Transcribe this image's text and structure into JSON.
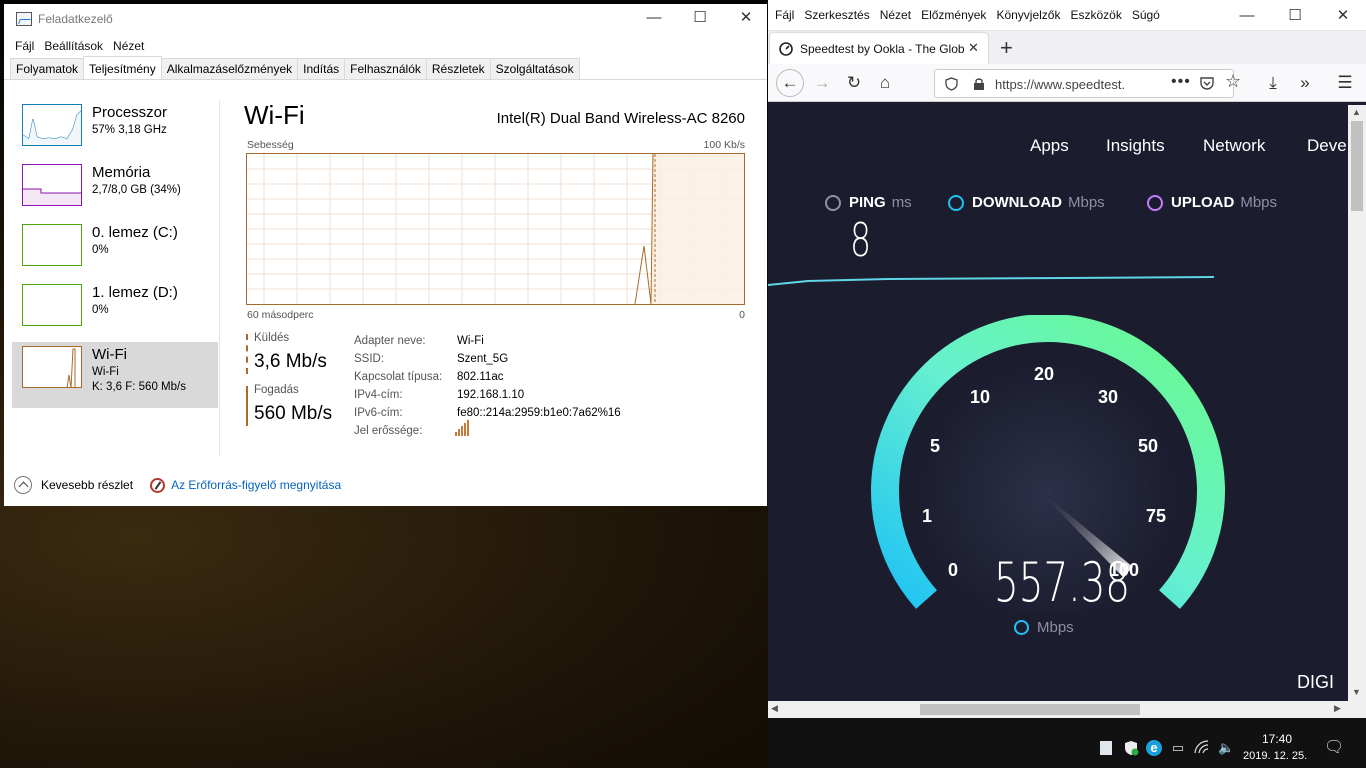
{
  "task_manager": {
    "title": "Feladatkezelő",
    "menu": [
      "Fájl",
      "Beállítások",
      "Nézet"
    ],
    "tabs": [
      "Folyamatok",
      "Teljesítmény",
      "Alkalmazáselőzmények",
      "Indítás",
      "Felhasználók",
      "Részletek",
      "Szolgáltatások"
    ],
    "active_tab": "Teljesítmény",
    "sidebar": [
      {
        "name": "Processzor",
        "sub1": "57%  3,18 GHz",
        "sub2": "",
        "sub3": ""
      },
      {
        "name": "Memória",
        "sub1": "2,7/8,0 GB (34%)",
        "sub2": "",
        "sub3": ""
      },
      {
        "name": "0. lemez (C:)",
        "sub1": "0%",
        "sub2": "",
        "sub3": ""
      },
      {
        "name": "1. lemez (D:)",
        "sub1": "0%",
        "sub2": "",
        "sub3": ""
      },
      {
        "name": "Wi-Fi",
        "sub1": "Wi-Fi",
        "sub2": "K: 3,6  F: 560 Mb/s",
        "sub3": ""
      }
    ],
    "main_title": "Wi-Fi",
    "adapter_model": "Intel(R) Dual Band Wireless-AC 8260",
    "chart": {
      "top_left_label": "Sebesség",
      "top_right_label": "100 Kb/s",
      "bottom_left_label": "60 másodperc",
      "bottom_right_label": "0"
    },
    "send": {
      "label": "Küldés",
      "value": "3,6 Mb/s"
    },
    "receive": {
      "label": "Fogadás",
      "value": "560 Mb/s"
    },
    "details": {
      "keys": [
        "Adapter neve:",
        "SSID:",
        "Kapcsolat típusa:",
        "IPv4-cím:",
        "IPv6-cím:",
        "Jel erőssége:"
      ],
      "values": [
        "Wi-Fi",
        "Szent_5G",
        "802.11ac",
        "192.168.1.10",
        "fe80::214a:2959:b1e0:7a62%16",
        ""
      ]
    },
    "footer": {
      "fewer_details": "Kevesebb részlet",
      "resource_monitor": "Az Erőforrás-figyelő megnyitása"
    }
  },
  "firefox": {
    "menu": [
      "Fájl",
      "Szerkesztés",
      "Nézet",
      "Előzmények",
      "Könyvjelzők",
      "Eszközök",
      "Súgó"
    ],
    "tab_title": "Speedtest by Ookla - The Global",
    "url": "https://www.speedtest.",
    "speedtest": {
      "nav": [
        "Apps",
        "Insights",
        "Network",
        "Deve"
      ],
      "ping_label": "PING",
      "ping_unit": "ms",
      "ping_value": "8",
      "download_label": "DOWNLOAD",
      "download_unit": "Mbps",
      "upload_label": "UPLOAD",
      "upload_unit": "Mbps",
      "gauge_value": "557.38",
      "gauge_unit": "Mbps",
      "gauge_ticks": [
        "0",
        "1",
        "5",
        "10",
        "20",
        "30",
        "50",
        "75",
        "100"
      ],
      "provider": "DIGI",
      "colors": {
        "accent_cyan": "#1ec2f5",
        "accent_green": "#6afa8a",
        "upload_purple": "#c57cff"
      }
    }
  },
  "taskbar": {
    "time": "17:40",
    "date": "2019. 12. 25."
  }
}
